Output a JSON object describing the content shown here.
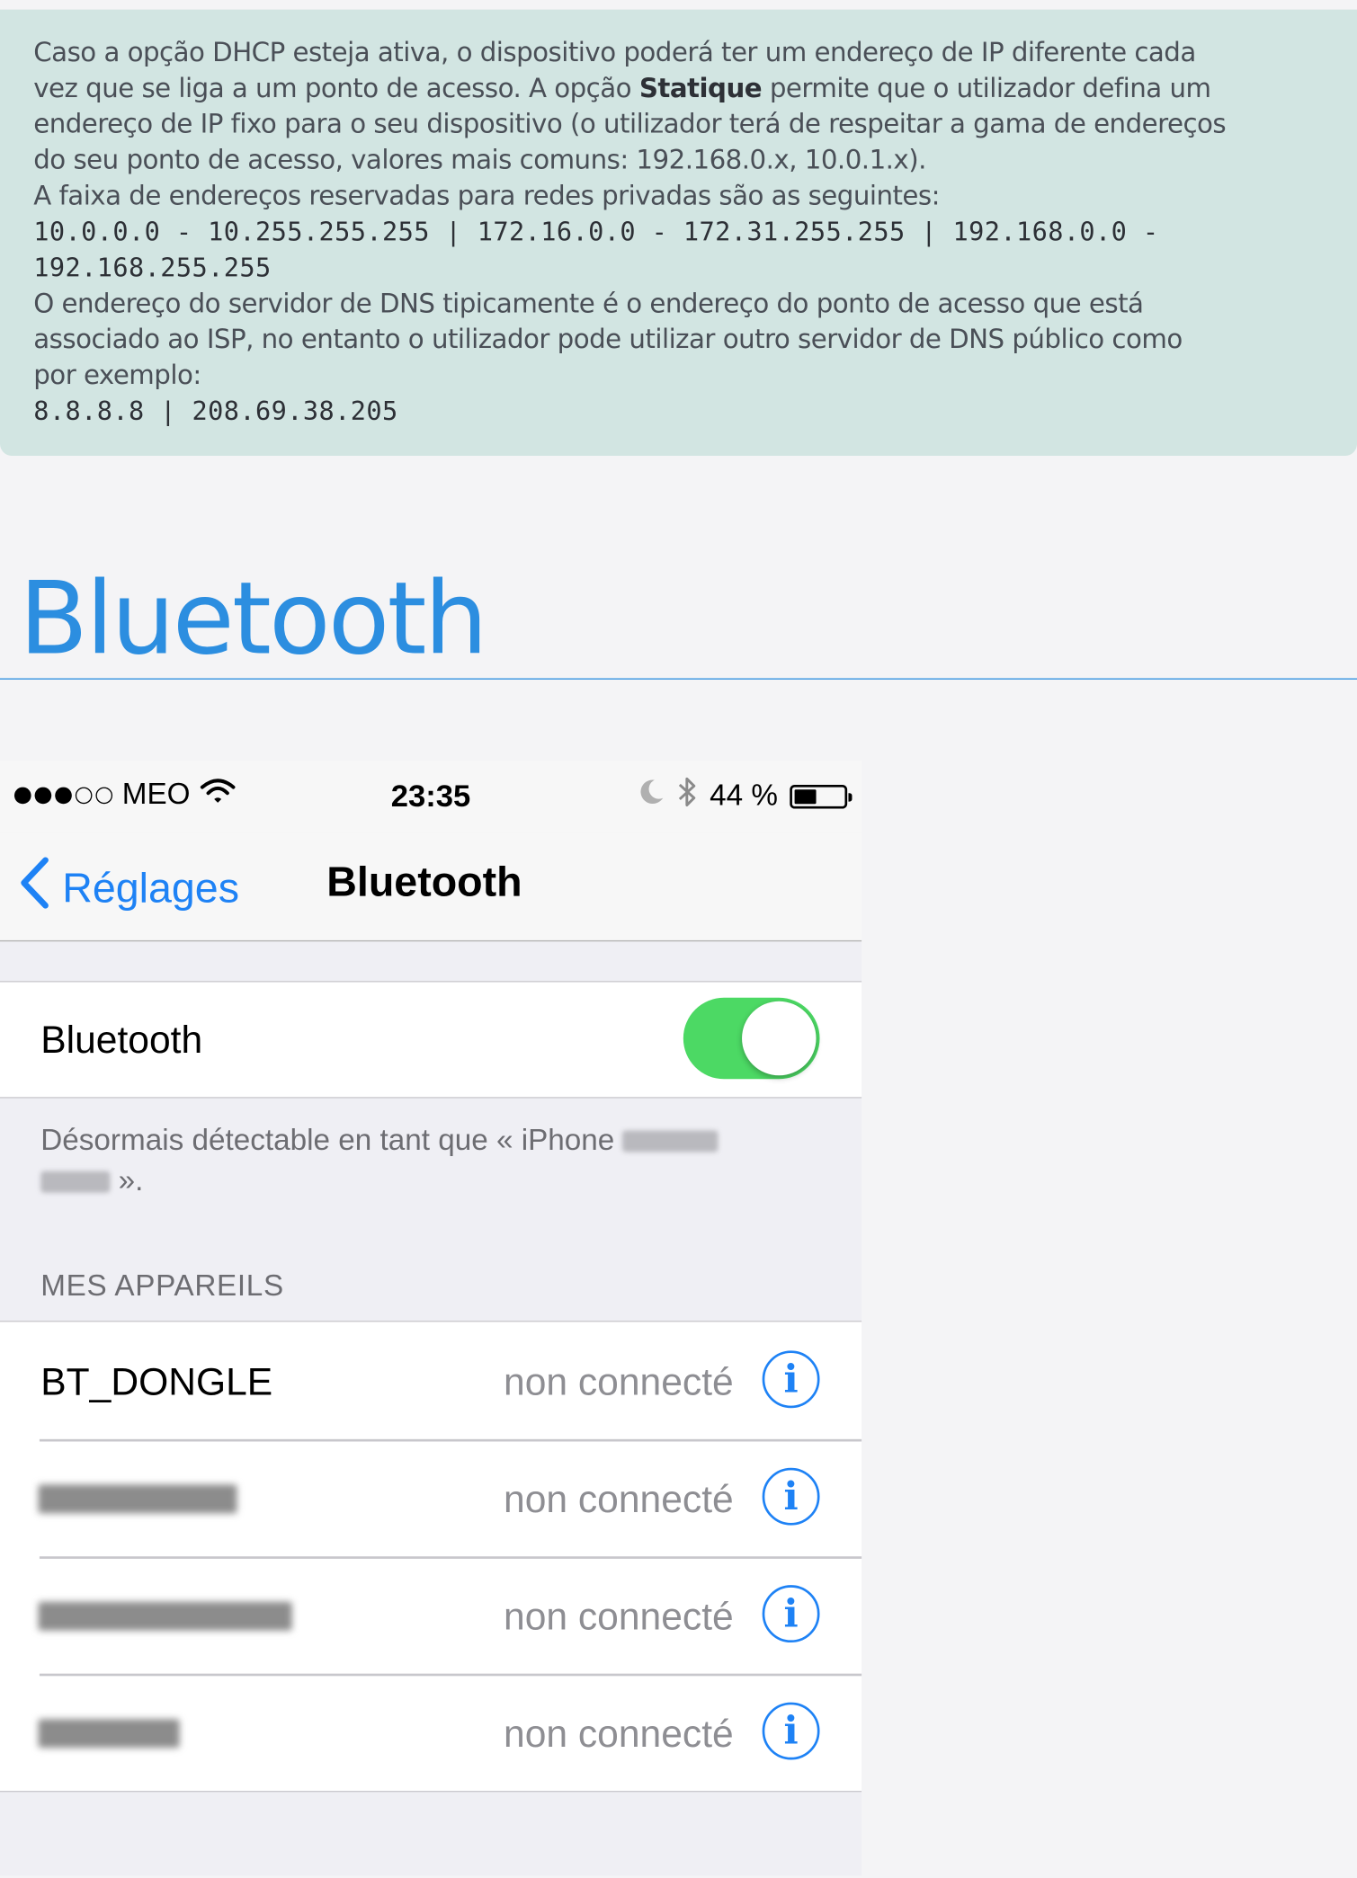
{
  "info": {
    "line1": "Caso a opção DHCP esteja ativa, o dispositivo poderá ter um endereço de IP diferente cada",
    "line2a": "vez que se liga a um ponto de acesso. A opção ",
    "line2b": "Statique",
    "line2c": " permite que o utilizador defina um",
    "line3": "endereço de IP fixo para o seu dispositivo (o utilizador terá de respeitar a gama de endereços",
    "line4": "do seu ponto de acesso, valores mais comuns: 192.168.0.x, 10.0.1.x).",
    "line5": "A faixa de endereços reservadas para redes privadas são as seguintes:",
    "ranges_line1": "10.0.0.0 - 10.255.255.255 | 172.16.0.0 - 172.31.255.255 | 192.168.0.0 -",
    "ranges_line2": "192.168.255.255",
    "dns_line1": "O endereço do servidor de DNS tipicamente é o endereço do ponto de acesso que está",
    "dns_line2": "associado ao ISP, no entanto o utilizador pode utilizar outro servidor de DNS público como",
    "dns_line3": "por exemplo:",
    "dns_servers": "8.8.8.8 | 208.69.38.205"
  },
  "section": {
    "title": "Bluetooth"
  },
  "phone": {
    "status": {
      "carrier": "MEO",
      "time": "23:35",
      "battery_text": "44 %",
      "battery_level": 0.44,
      "signal_bars_filled": 3,
      "signal_bars_total": 5
    },
    "nav": {
      "back_label": "Réglages",
      "title": "Bluetooth"
    },
    "bluetooth_row": {
      "label": "Bluetooth",
      "enabled": true
    },
    "discoverable_note": {
      "prefix": "Désormais détectable en tant que « iPhone",
      "suffix": "»."
    },
    "devices_header": "MES APPAREILS",
    "devices": [
      {
        "name": "BT_DONGLE",
        "status": "non connecté"
      },
      {
        "name": "",
        "status": "non connecté"
      },
      {
        "name": "",
        "status": "non connecté"
      },
      {
        "name": "",
        "status": "non connecté"
      }
    ],
    "info_glyph": "i",
    "colors": {
      "accent": "#1e82f5",
      "toggle_on": "#4cd964",
      "heading_blue": "#2c8ee0",
      "info_box_bg": "#d2e5e2"
    }
  }
}
